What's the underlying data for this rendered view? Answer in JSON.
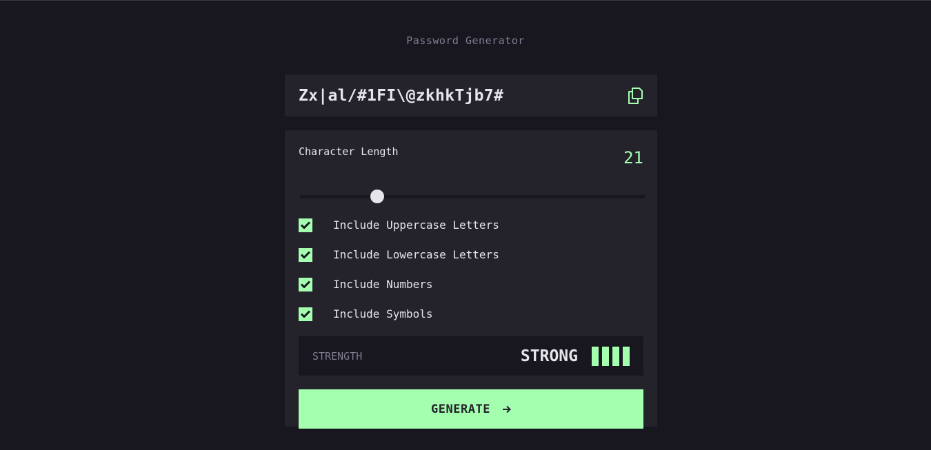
{
  "app": {
    "title": "Password Generator"
  },
  "password": {
    "value": "Zx|al/#1FI\\@zkhkTjb7#",
    "copy_icon": "copy-icon"
  },
  "length": {
    "label": "Character Length",
    "value": "21",
    "slider_fraction": 0.225
  },
  "options": [
    {
      "label": "Include Uppercase Letters",
      "checked": true
    },
    {
      "label": "Include Lowercase Letters",
      "checked": true
    },
    {
      "label": "Include Numbers",
      "checked": true
    },
    {
      "label": "Include Symbols",
      "checked": true
    }
  ],
  "strength": {
    "label": "STRENGTH",
    "value": "STRONG",
    "bars_filled": 4,
    "bars_total": 4
  },
  "generate": {
    "label": "GENERATE",
    "icon": "arrow-right-icon"
  },
  "colors": {
    "accent": "#a4ffaf",
    "background": "#18171f",
    "panel": "#24232c",
    "muted_text": "#817d92",
    "text": "#e6e5ea"
  }
}
